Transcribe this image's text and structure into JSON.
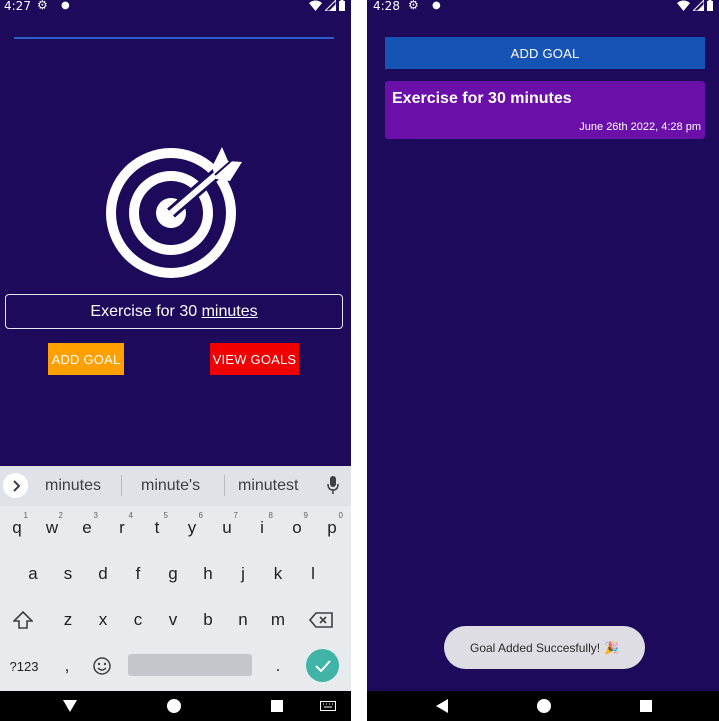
{
  "left_screen": {
    "status": {
      "time": "4:27"
    },
    "goal_input": {
      "prefix": "Exercise for 30 ",
      "underlined": "minutes"
    },
    "add_goal_label": "ADD GOAL",
    "view_goals_label": "VIEW GOALS",
    "keyboard": {
      "suggestions": [
        "minutes",
        "minute's",
        "minutest"
      ],
      "row1": [
        "q",
        "w",
        "e",
        "r",
        "t",
        "y",
        "u",
        "i",
        "o",
        "p"
      ],
      "row1_hints": [
        "1",
        "2",
        "3",
        "4",
        "5",
        "6",
        "7",
        "8",
        "9",
        "0"
      ],
      "row2": [
        "a",
        "s",
        "d",
        "f",
        "g",
        "h",
        "j",
        "k",
        "l"
      ],
      "row3": [
        "z",
        "x",
        "c",
        "v",
        "b",
        "n",
        "m"
      ],
      "symbols_label": "?123",
      "comma": ",",
      "period": "."
    }
  },
  "right_screen": {
    "status": {
      "time": "4:28"
    },
    "add_goal_label": "ADD GOAL",
    "goals": [
      {
        "title": "Exercise for 30 minutes",
        "date": "June 26th 2022, 4:28 pm"
      }
    ],
    "toast": {
      "text": "Goal Added Succesfully!",
      "emoji": "🎉"
    }
  },
  "colors": {
    "background": "#1e0a5b",
    "add_goal_left": "#ffa000",
    "view_goals": "#f00000",
    "add_goal_right": "#1554b4",
    "goal_card": "#6a0fa8",
    "enter_key": "#3fb4a7"
  },
  "icons": [
    "target-icon",
    "settings-icon",
    "wifi-icon",
    "signal-icon",
    "battery-icon",
    "chevron-right-icon",
    "mic-icon",
    "shift-icon",
    "backspace-icon",
    "emoji-icon",
    "check-icon",
    "back-icon",
    "home-icon",
    "recents-icon",
    "keyboard-icon",
    "party-popper-icon"
  ]
}
